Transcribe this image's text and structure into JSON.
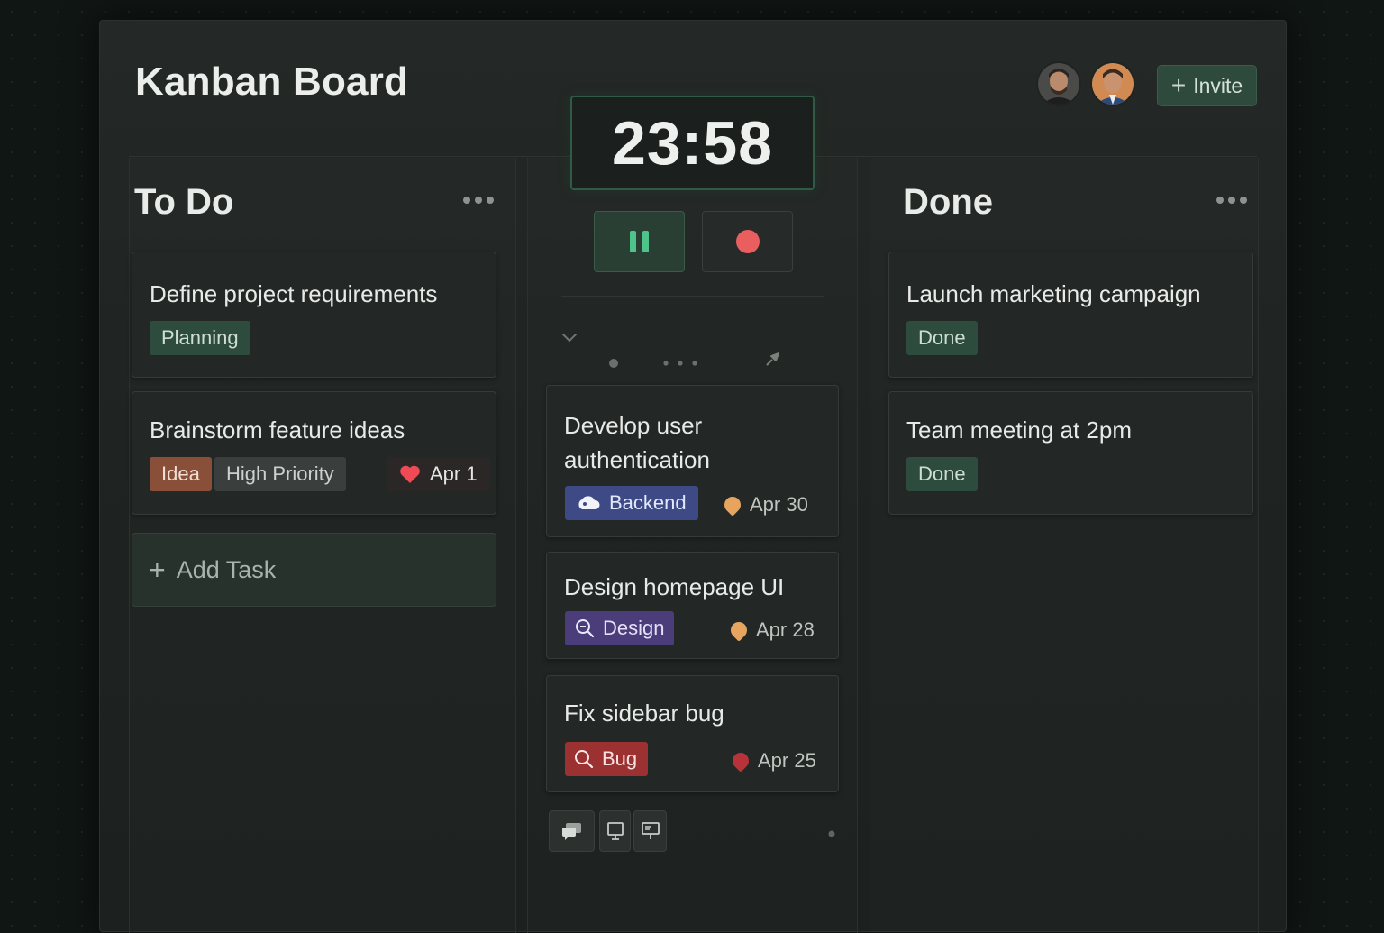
{
  "header": {
    "title": "Kanban Board",
    "invite_label": "Invite",
    "avatars": [
      "avatar-1",
      "avatar-2"
    ]
  },
  "timer": {
    "time": "23:58",
    "controls": [
      "pause-icon",
      "record-icon"
    ]
  },
  "colors": {
    "accent_green": "#2e4a3d",
    "record_red": "#e95e5e",
    "tag_idea": "#8a4f38",
    "tag_backend": "#3d4a86",
    "tag_design": "#4a3d7a",
    "tag_bug": "#9b3131"
  },
  "columns": {
    "todo": {
      "title": "To Do",
      "cards": [
        {
          "title": "Define project requirements",
          "tags": [
            "Planning"
          ]
        },
        {
          "title": "Brainstorm feature ideas",
          "tags": [
            "Idea",
            "High Priority"
          ],
          "date": "Apr 1",
          "date_icon": "heart-icon"
        }
      ],
      "add_label": "Add Task"
    },
    "in_progress": {
      "cards": [
        {
          "title": "Develop user authentication",
          "tag": "Backend",
          "tag_icon": "cloud-icon",
          "date": "Apr 30"
        },
        {
          "title": "Design homepage UI",
          "tag": "Design",
          "tag_icon": "search-icon",
          "date": "Apr 28"
        },
        {
          "title": "Fix sidebar bug",
          "tag": "Bug",
          "tag_icon": "search-icon",
          "date": "Apr 25"
        }
      ],
      "toolbar": [
        "chat-icon",
        "monitor-icon",
        "presentation-icon"
      ]
    },
    "done": {
      "title": "Done",
      "cards": [
        {
          "title": "Launch marketing campaign",
          "tags": [
            "Done"
          ]
        },
        {
          "title": "Team meeting at 2pm",
          "tags": [
            "Done"
          ]
        }
      ]
    }
  }
}
